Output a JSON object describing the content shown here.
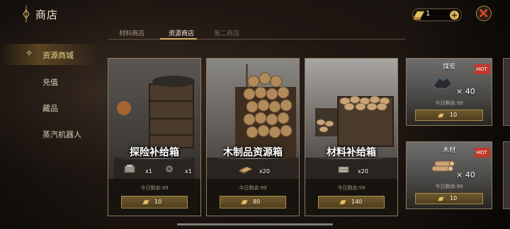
{
  "header": {
    "title": "商店",
    "currency_value": "1",
    "currency_add": "+"
  },
  "tabs": [
    {
      "label": "材料商店",
      "active": false
    },
    {
      "label": "资源商店",
      "active": true
    },
    {
      "label": "第二商店",
      "active": false
    }
  ],
  "sidebar": {
    "items": [
      {
        "label": "资源商城",
        "active": true
      },
      {
        "label": "充值",
        "active": false
      },
      {
        "label": "藏品",
        "active": false
      },
      {
        "label": "蒸汽机器人",
        "active": false
      }
    ]
  },
  "cards": [
    {
      "title": "探险补给箱",
      "items": [
        {
          "icon": "supply-pack-icon",
          "qty": "x1"
        },
        {
          "icon": "gear-part-icon",
          "qty": "x1"
        }
      ],
      "stock": "今日剩余:99",
      "price": "10"
    },
    {
      "title": "木制品资源箱",
      "items": [
        {
          "icon": "wood-plank-icon",
          "qty": "x20"
        }
      ],
      "stock": "今日剩余:99",
      "price": "80"
    },
    {
      "title": "材料补给箱",
      "items": [
        {
          "icon": "material-bundle-icon",
          "qty": "x20"
        }
      ],
      "stock": "今日剩余:99",
      "price": "140"
    }
  ],
  "side_cards": [
    {
      "title": "煤炭",
      "badge": "HOT",
      "qty": "× 40",
      "stock": "今日剩余:99",
      "price": "10",
      "icon": "coal-icon"
    },
    {
      "title": "木材",
      "badge": "HOT",
      "qty": "× 40",
      "stock": "今日剩余:99",
      "price": "10",
      "icon": "logs-icon"
    }
  ],
  "colors": {
    "accent_gold": "#d6b26a",
    "hot_red": "#c0392b"
  }
}
